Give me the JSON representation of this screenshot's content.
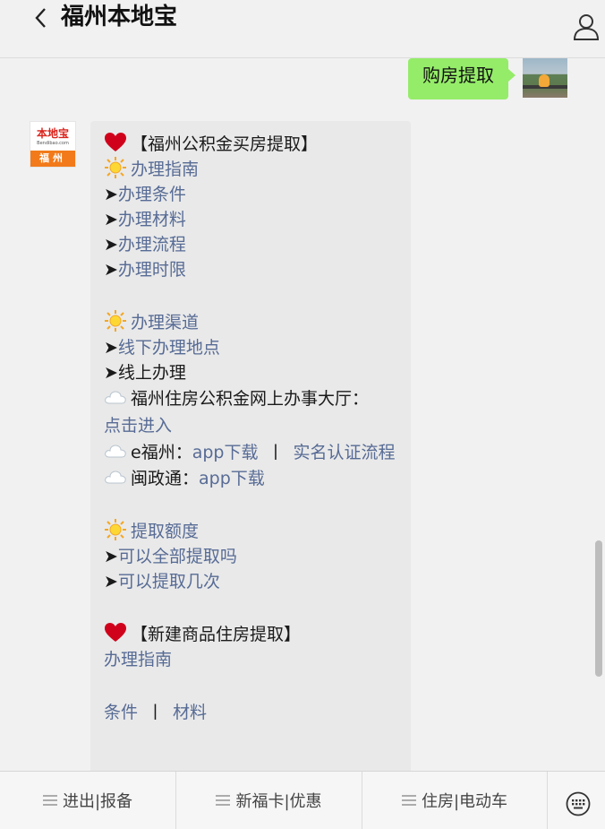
{
  "header": {
    "title": "福州本地宝"
  },
  "sent_message": {
    "text": "购房提取"
  },
  "bot_avatar": {
    "brand": "本地宝",
    "url": "Bendibao.com",
    "city": "福州"
  },
  "reply": {
    "title1": "【福州公积金买房提取】",
    "section1": "办理指南",
    "items1": [
      "办理条件",
      "办理材料",
      "办理流程",
      "办理时限"
    ],
    "section2": "办理渠道",
    "items2_link": "线下办理地点",
    "items2_text": "线上办理",
    "online1_label": "福州住房公积金网上办事大厅：",
    "online1_link": "点击进入",
    "online2_label": "e福州：",
    "online2_link1": "app下载",
    "online2_sep": "丨",
    "online2_link2": "实名认证流程",
    "online3_label": "闽政通：",
    "online3_link": "app下载",
    "section3": "提取额度",
    "items3": [
      "可以全部提取吗",
      "可以提取几次"
    ],
    "title2": "【新建商品住房提取】",
    "guide_link": "办理指南",
    "cond_link": "条件",
    "cond_sep": "丨",
    "mat_link": "材料"
  },
  "bottom_menu": [
    {
      "label": "进出|报备"
    },
    {
      "label": "新福卡|优惠"
    },
    {
      "label": "住房|电动车"
    }
  ],
  "colors": {
    "link": "#576b95",
    "sent_bubble": "#95ec69",
    "recv_bubble": "#e9e9e9",
    "background": "#f1f1f1"
  }
}
